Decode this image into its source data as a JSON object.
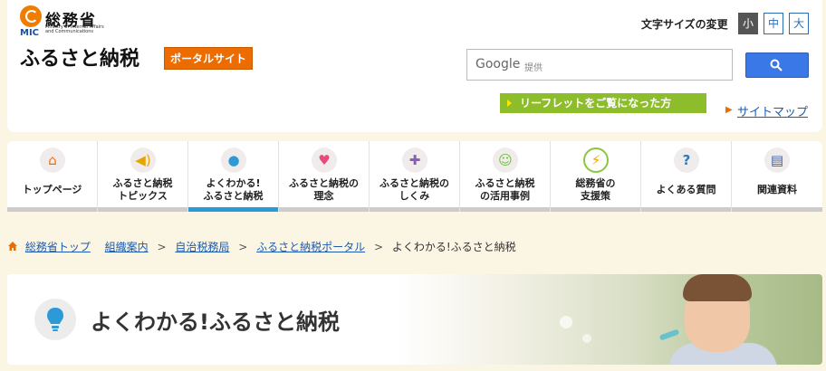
{
  "ministry": {
    "mark": "MIC",
    "name": "総務省",
    "english": "Ministry of Internal Affairs and Communications"
  },
  "site": {
    "title": "ふるさと納税",
    "badge": "ポータルサイト"
  },
  "font_size": {
    "label": "文字サイズの変更",
    "options": [
      "小",
      "中",
      "大"
    ],
    "selected": "小"
  },
  "search": {
    "brand": "Google",
    "provider": "提供"
  },
  "leaflet": {
    "label": "リーフレットをご覧になった方"
  },
  "sitemap": {
    "label": "サイトマップ"
  },
  "nav": {
    "items": [
      {
        "label": "トップページ",
        "icon": "home-icon"
      },
      {
        "label": "ふるさと納税\nトピックス",
        "icon": "megaphone-icon"
      },
      {
        "label": "よくわかる!\nふるさと納税",
        "icon": "lightbulb-icon",
        "active": true
      },
      {
        "label": "ふるさと納税の\n理念",
        "icon": "heart-icon"
      },
      {
        "label": "ふるさと納税の\nしくみ",
        "icon": "puzzle-icon"
      },
      {
        "label": "ふるさと納税\nの活用事例",
        "icon": "smile-icon"
      },
      {
        "label": "総務省の\n支援策",
        "icon": "lightning-icon"
      },
      {
        "label": "よくある質問",
        "icon": "question-bubble-icon"
      },
      {
        "label": "関連資料",
        "icon": "document-icon"
      }
    ]
  },
  "breadcrumb": {
    "items": [
      "総務省トップ",
      "組織案内",
      "自治税務局",
      "ふるさと納税ポータル"
    ],
    "current": "よくわかる!ふるさと納税"
  },
  "hero": {
    "title": "よくわかる!ふるさと納税"
  },
  "colors": {
    "accent": "#ec6c00",
    "link": "#1a5bb0",
    "active_nav": "#2c9ad7",
    "leaflet": "#8ebd2c",
    "search": "#3b78e7"
  }
}
